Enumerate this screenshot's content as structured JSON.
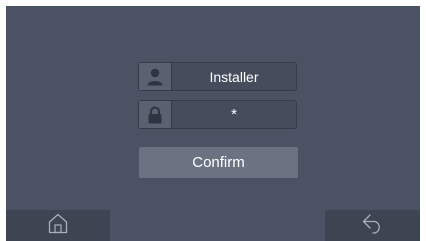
{
  "login": {
    "username_value": "Installer",
    "password_value": "*",
    "confirm_label": "Confirm"
  },
  "icons": {
    "user": "user-icon",
    "lock": "lock-icon",
    "home": "home-icon",
    "back": "back-arrow-icon"
  },
  "colors": {
    "background": "#4a5264",
    "field_background": "#454c5c",
    "confirm_button": "#6b7282",
    "nav_bar": "#3d4452",
    "text": "#ffffff"
  }
}
